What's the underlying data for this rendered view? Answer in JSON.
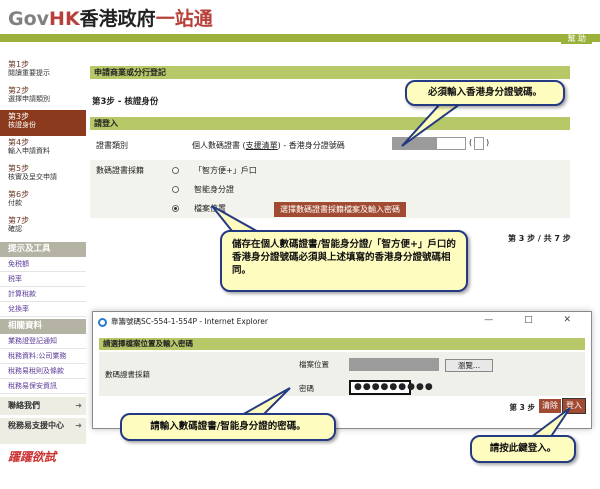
{
  "brand": {
    "gov": "Gov",
    "hk": "HK",
    "name_a": "香港政府",
    "name_b": "一站通"
  },
  "header": {
    "help": "幫 助"
  },
  "sidebar": {
    "steps": [
      {
        "num": "第1步",
        "label": "閱讀重要提示"
      },
      {
        "num": "第2步",
        "label": "選擇申請類別"
      },
      {
        "num": "第3步",
        "label": "核證身份"
      },
      {
        "num": "第4步",
        "label": "輸入申請資料"
      },
      {
        "num": "第5步",
        "label": "核實及呈交申請"
      },
      {
        "num": "第6步",
        "label": "付款"
      },
      {
        "num": "第7步",
        "label": "確認"
      }
    ],
    "tools_head": "提示及工具",
    "tools": [
      "免税額",
      "税率",
      "計算稅款",
      "兌換率"
    ],
    "info_head": "相關資料",
    "info": [
      "業務證登記通知",
      "稅務資料:公司業務",
      "稅務易稅則及條款",
      "稅務易保安資訊"
    ],
    "contact": "聯絡我們",
    "support": "稅務易支援中心",
    "slogan": "躍躍欲試"
  },
  "main": {
    "title": "申請商業或分行登記",
    "step": "第3步 - 核證身份",
    "section": "請登入",
    "cert_type_label": "證書類別",
    "cert_type_text_a": "個人數碼證書 (",
    "cert_type_link": "支援清單",
    "cert_type_text_b": ") - 香港身分證號碼",
    "paren_open": "(",
    "paren_close": ")",
    "store_label": "數碼證書採籍",
    "store_options": [
      "「智方便+」戶口",
      "智能身分證",
      "檔案位置"
    ],
    "select_button": "選擇數碼證書採籍檔案及輸入密碼",
    "page_count": "第 3 步 / 共 7 步"
  },
  "callouts": {
    "hkid": "必須輸入香港身分證號碼。",
    "notice": "儲存在個人數碼證書/智能身分證/「智方便+」戶口的香港身分證號碼必須與上述填寫的香港身分證號碼相同。",
    "password": "請輸入數碼證書/智能身分證的密碼。",
    "login": "請按此鍵登入。"
  },
  "dialog": {
    "title": "靠籌號碼SC-554-1-554P - Internet Explorer",
    "window_controls": "— □ ✕",
    "header": "請選擇檔案位置及輸入密碼",
    "store_label": "數碼證書採籍",
    "file_label": "檔案位置",
    "browse": "瀏覽...",
    "password_label": "密碼",
    "password_value": "●●●●●●●●●",
    "page": "第 3 步",
    "clear": "清除",
    "login": "登入"
  },
  "colors": {
    "accent": "#9ab23c",
    "step_active": "#8b3a1e",
    "button": "#a24b33",
    "callout_fill": "#fefcbf",
    "callout_border": "#243a82"
  }
}
